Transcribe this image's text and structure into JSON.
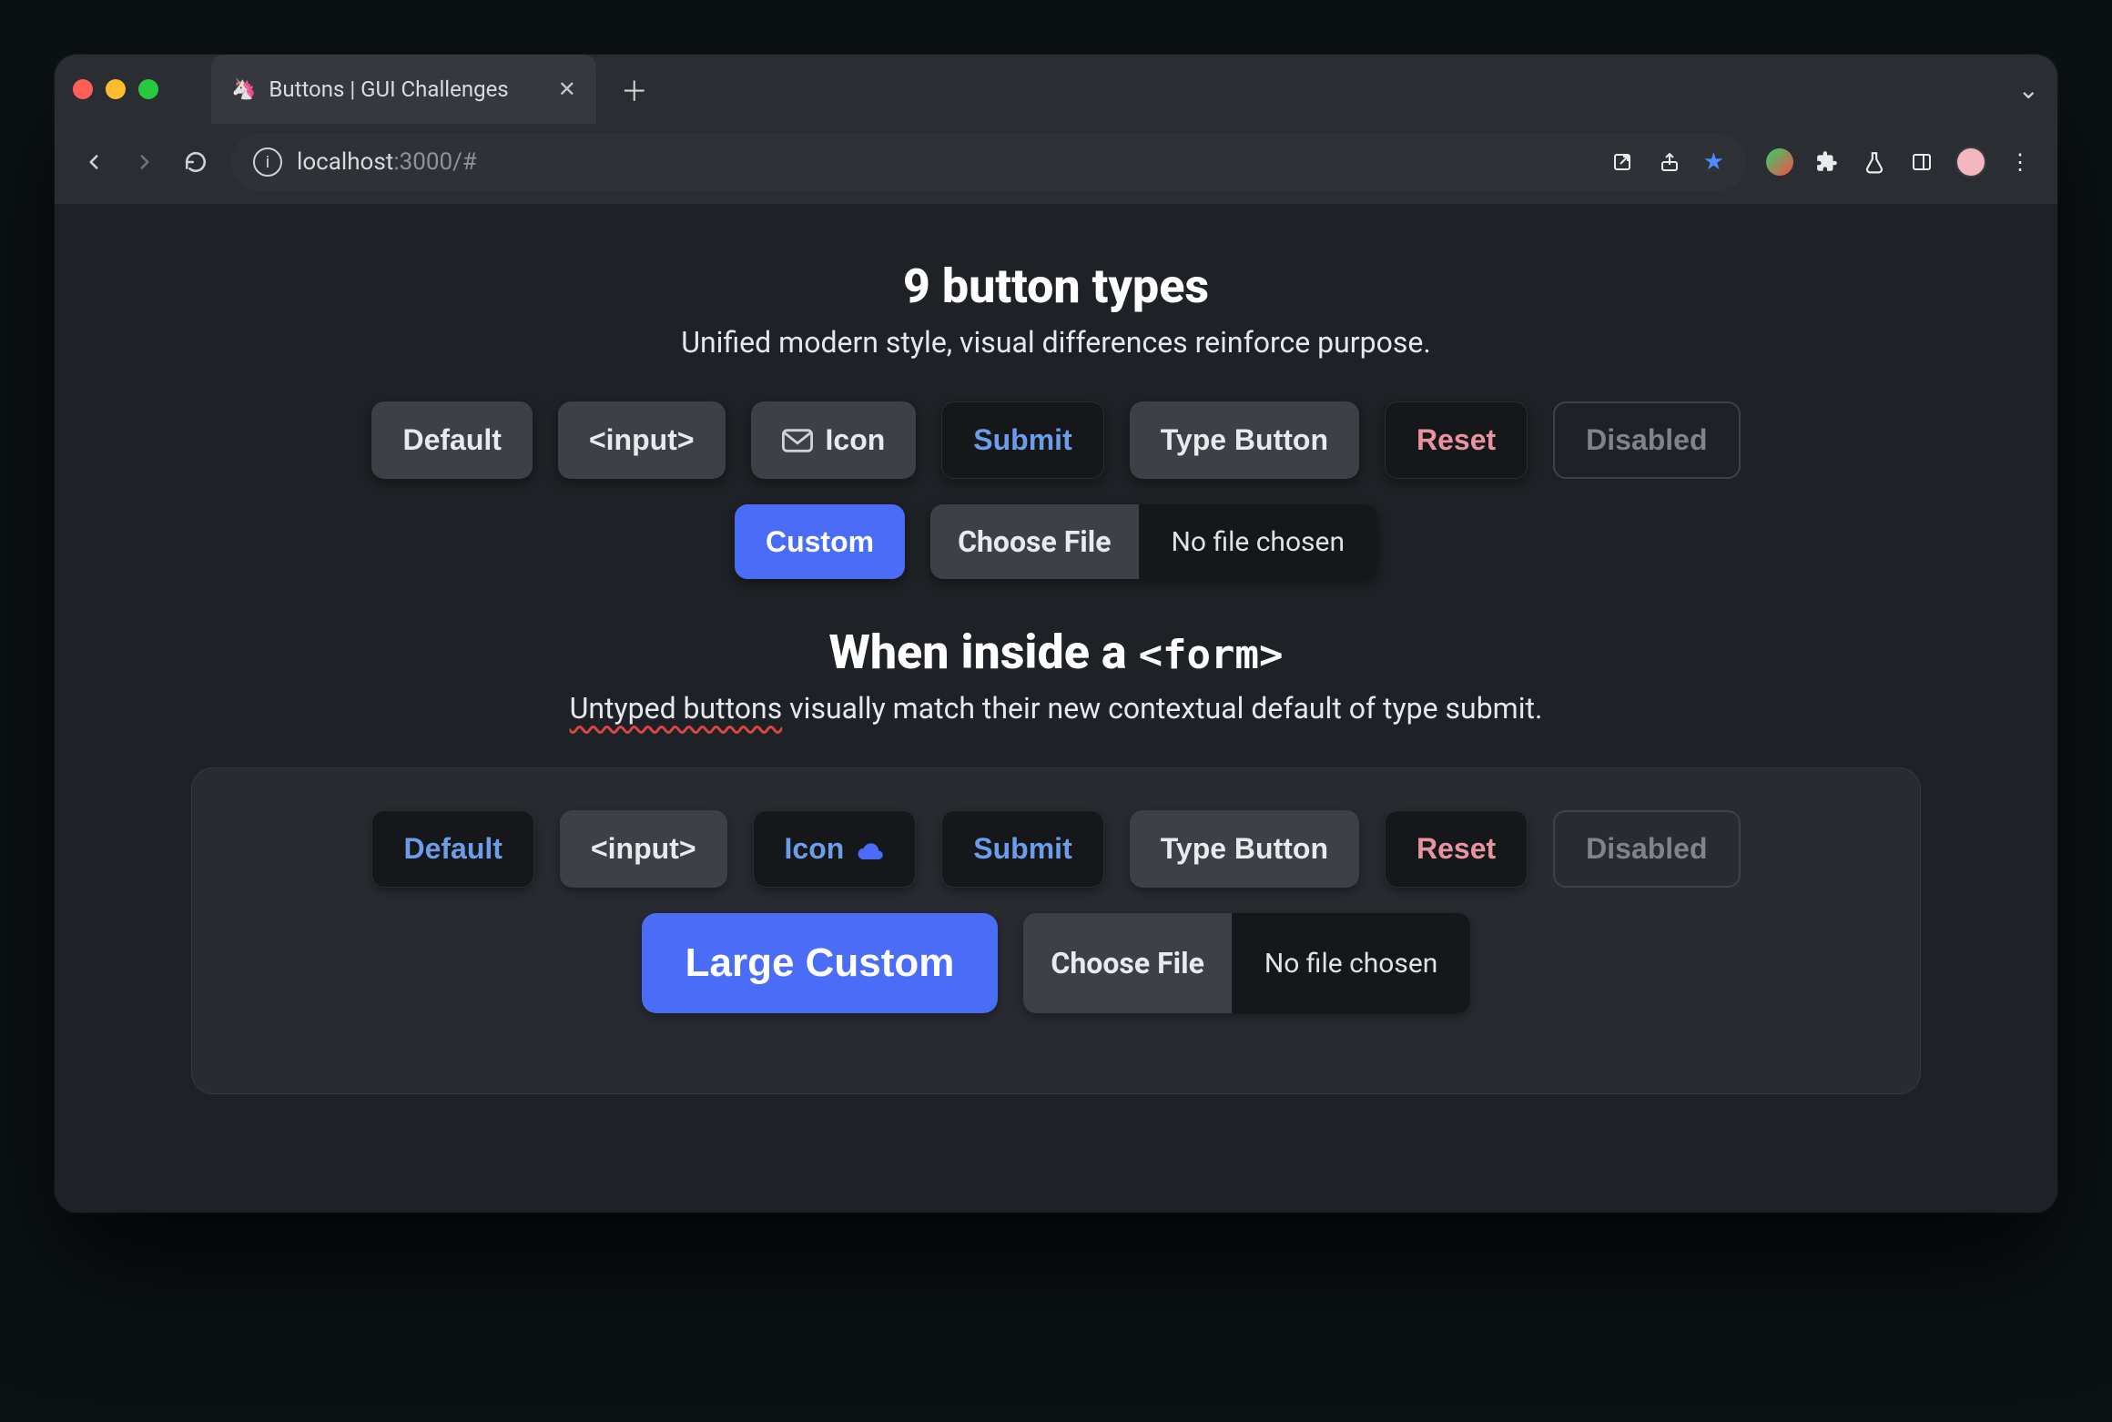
{
  "browser": {
    "tab_title": "Buttons | GUI Challenges",
    "url_host": "localhost",
    "url_port": ":3000",
    "url_path": "/#"
  },
  "section1": {
    "heading": "9 button types",
    "subtitle": "Unified modern style, visual differences reinforce purpose."
  },
  "buttons1": {
    "default": "Default",
    "input": "<input>",
    "icon": "Icon",
    "submit": "Submit",
    "typebutton": "Type Button",
    "reset": "Reset",
    "disabled": "Disabled",
    "custom": "Custom",
    "choose": "Choose File",
    "file_status": "No file chosen"
  },
  "section2": {
    "heading_pre": "When inside a ",
    "heading_code": "<form>",
    "subtitle_hl": "Untyped buttons",
    "subtitle_rest": " visually match their new contextual default of type submit."
  },
  "buttons2": {
    "default": "Default",
    "input": "<input>",
    "icon": "Icon",
    "submit": "Submit",
    "typebutton": "Type Button",
    "reset": "Reset",
    "disabled": "Disabled",
    "custom": "Large Custom",
    "choose": "Choose File",
    "file_status": "No file chosen"
  }
}
